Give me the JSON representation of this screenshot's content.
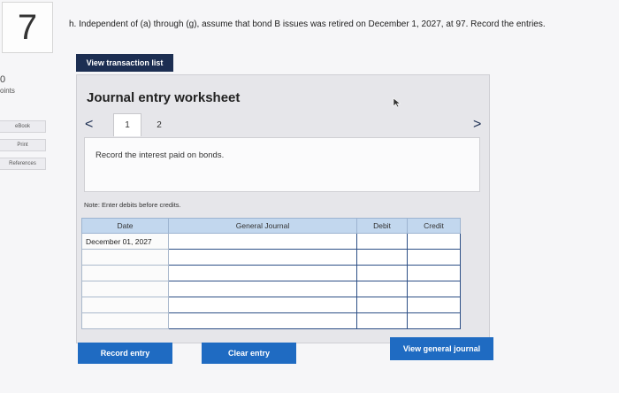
{
  "question": {
    "number": "7",
    "text": "h. Independent of (a) through (g), assume that bond B issues was retired on December 1, 2027, at 97. Record the entries."
  },
  "sidebar": {
    "points_value": "0",
    "points_label": "oints",
    "ebook_label": "eBook",
    "print_label": "Print",
    "references_label": "References"
  },
  "buttons": {
    "view_transaction_list": "View transaction list",
    "record_entry": "Record entry",
    "clear_entry": "Clear entry",
    "view_general_journal": "View general journal"
  },
  "worksheet": {
    "title": "Journal entry worksheet",
    "nav_prev": "<",
    "nav_next": ">",
    "tabs": [
      "1",
      "2"
    ],
    "active_tab": "1",
    "instruction": "Record the interest paid on bonds.",
    "note": "Note: Enter debits before credits."
  },
  "journal_table": {
    "headers": {
      "date": "Date",
      "general_journal": "General Journal",
      "debit": "Debit",
      "credit": "Credit"
    },
    "rows": [
      {
        "date": "December 01, 2027",
        "account": "",
        "debit": "",
        "credit": ""
      },
      {
        "date": "",
        "account": "",
        "debit": "",
        "credit": ""
      },
      {
        "date": "",
        "account": "",
        "debit": "",
        "credit": ""
      },
      {
        "date": "",
        "account": "",
        "debit": "",
        "credit": ""
      },
      {
        "date": "",
        "account": "",
        "debit": "",
        "credit": ""
      },
      {
        "date": "",
        "account": "",
        "debit": "",
        "credit": ""
      }
    ]
  },
  "colors": {
    "navy": "#1c2e52",
    "blue": "#1f6bc2",
    "header_blue": "#c2d7ee",
    "cell_border": "#2d4f86"
  }
}
